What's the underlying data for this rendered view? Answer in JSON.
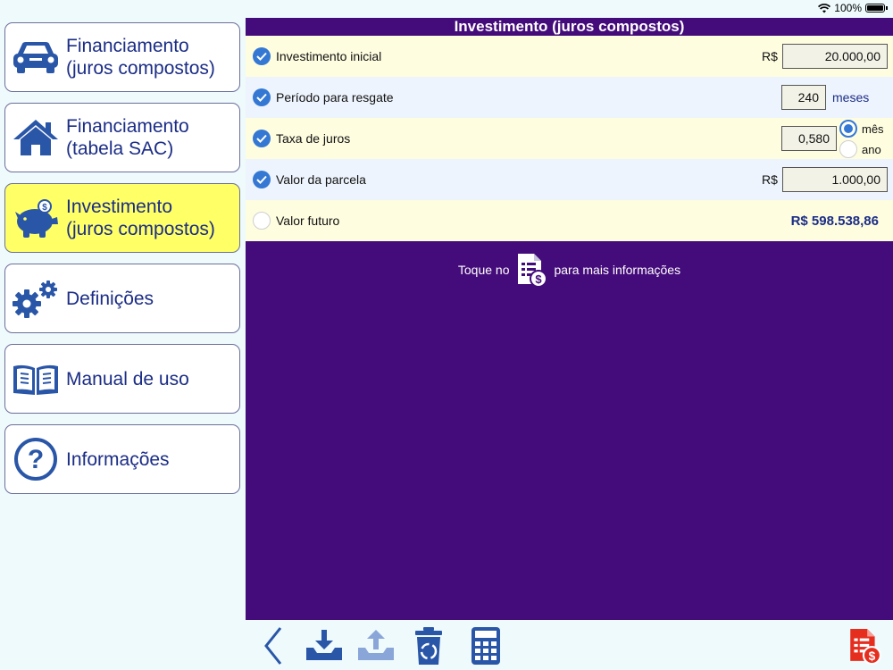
{
  "status": {
    "battery": "100%"
  },
  "sidebar": {
    "items": [
      {
        "label1": "Financiamento",
        "label2": "(juros compostos)",
        "icon": "car-icon",
        "active": false
      },
      {
        "label1": "Financiamento",
        "label2": "(tabela SAC)",
        "icon": "house-icon",
        "active": false
      },
      {
        "label1": "Investimento",
        "label2": "(juros compostos)",
        "icon": "piggy-bank-icon",
        "active": true
      },
      {
        "label1": "Definições",
        "icon": "gears-icon",
        "active": false
      },
      {
        "label1": "Manual de uso",
        "icon": "book-icon",
        "active": false
      },
      {
        "label1": "Informações",
        "icon": "question-icon",
        "active": false
      }
    ]
  },
  "main": {
    "title": "Investimento (juros compostos)",
    "rows": {
      "initial": {
        "label": "Investimento inicial",
        "currency": "R$",
        "value": "20.000,00",
        "checked": true
      },
      "period": {
        "label": "Período para resgate",
        "value": "240",
        "unit": "meses",
        "checked": true
      },
      "rate": {
        "label": "Taxa de juros",
        "value": "0,580",
        "option_month": "mês",
        "option_year": "ano",
        "selected": "mês",
        "checked": true
      },
      "installment": {
        "label": "Valor da parcela",
        "currency": "R$",
        "value": "1.000,00",
        "checked": true
      },
      "future": {
        "label": "Valor futuro",
        "value": "R$ 598.538,86",
        "checked": false
      }
    },
    "hint": {
      "before": "Toque no",
      "after": "para mais informações"
    }
  },
  "toolbar": {
    "icons": [
      "back-chevron-icon",
      "download-tray-icon",
      "upload-tray-icon",
      "recycle-trash-icon",
      "calculator-icon",
      "report-dollar-icon"
    ]
  },
  "colors": {
    "accent": "#440c7a",
    "brand": "#1b2d86",
    "active_item": "#ffff66",
    "check": "#3478d4"
  }
}
